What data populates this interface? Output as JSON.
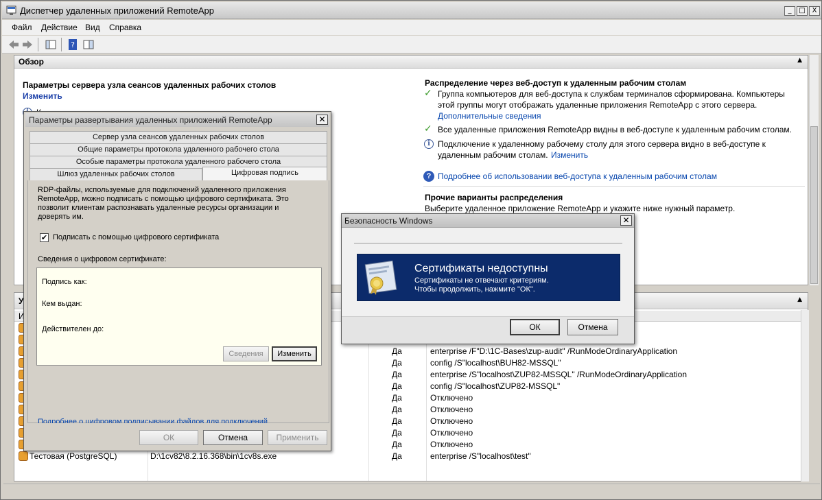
{
  "window": {
    "title": "Диспетчер удаленных приложений RemoteApp",
    "minimize": "_",
    "maximize": "□",
    "close": "X"
  },
  "menu": [
    "Файл",
    "Действие",
    "Вид",
    "Справка"
  ],
  "overview": {
    "header": "Обзор",
    "left": {
      "heading": "Параметры сервера узла сеансов удаленных рабочих столов",
      "change_link": "Изменить",
      "partial_text": "К"
    },
    "right": {
      "heading": "Распределение через веб-доступ к удаленным рабочим столам",
      "item1_line1": "Группа компьютеров для веб-доступа к службам терминалов сформирована. Компьютеры",
      "item1_line2": "этой группы могут отображать удаленные приложения RemoteApp с этого сервера.",
      "item1_link": "Дополнительные сведения",
      "item2": "Все удаленные приложения RemoteApp видны в веб-доступе к удаленным рабочим столам.",
      "item3_line1": "Подключение к удаленному рабочему столу для этого сервера видно в веб-доступе к",
      "item3_line2": "удаленным рабочим столам.",
      "item3_link": "Изменить",
      "help_link": "Подробнее об использовании веб-доступа к удаленным рабочим столам",
      "other_heading": "Прочие варианты распределения",
      "other_text": "Выберите удаленное приложение RemoteApp и укажите ниже нужный параметр."
    }
  },
  "programs": {
    "header_partial": "У",
    "col_partial": "И",
    "rows": [
      {
        "name": "",
        "path": "",
        "yes": "",
        "args": "ryApplication"
      },
      {
        "name": "",
        "path": "",
        "yes": "",
        "args": "ryApplication"
      },
      {
        "name": "",
        "path": "",
        "yes": "Да",
        "args": "enterprise /F\"D:\\1C-Bases\\zup-audit\" /RunModeOrdinaryApplication"
      },
      {
        "name": "",
        "path": "",
        "yes": "Да",
        "args": "config /S\"localhost\\BUH82-MSSQL\""
      },
      {
        "name": "",
        "path": "",
        "yes": "Да",
        "args": "enterprise /S\"localhost\\ZUP82-MSSQL\" /RunModeOrdinaryApplication"
      },
      {
        "name": "",
        "path": "",
        "yes": "Да",
        "args": "config /S\"localhost\\ZUP82-MSSQL\""
      },
      {
        "name": "",
        "path": "",
        "yes": "Да",
        "args": "Отключено"
      },
      {
        "name": "",
        "path": "calc.exe",
        "yes": "Да",
        "args": "Отключено"
      },
      {
        "name": "",
        "path": "writer.exe",
        "yes": "Да",
        "args": "Отключено"
      },
      {
        "name": "",
        "path": "xe",
        "yes": "Да",
        "args": "Отключено"
      },
      {
        "name": "",
        "path": "msc",
        "yes": "Да",
        "args": "Отключено"
      },
      {
        "name": "Тестовая (PostgreSQL)",
        "path": "D:\\1cv82\\8.2.16.368\\bin\\1cv8s.exe",
        "yes": "Да",
        "args": "enterprise /S\"localhost\\test\""
      }
    ]
  },
  "deploy_dialog": {
    "title": "Параметры развертывания удаленных приложений RemoteApp",
    "tabs": [
      "Сервер узла сеансов удаленных рабочих столов",
      "Общие параметры протокола удаленного рабочего стола",
      "Особые параметры протокола удаленного рабочего стола",
      "Шлюз удаленных рабочих столов",
      "Цифровая подпись"
    ],
    "description_lines": [
      "RDP-файлы, используемые для подключений удаленного приложения",
      "RemoteApp, можно подписать с помощью цифрового сертификата. Это",
      "позволит клиентам распознавать удаленные ресурсы организации и",
      "доверять им."
    ],
    "checkbox_label": "Подписать с помощью цифрового сертификата",
    "checkbox_mark": "✔",
    "cert_group_label": "Сведения о цифровом сертификате:",
    "signed_as": "Подпись как:",
    "issued_by": "Кем выдан:",
    "valid_until": "Действителен до:",
    "details_button": "Сведения",
    "change_button": "Изменить",
    "help_link": "Подробнее о цифровом подписывании файлов для подключений",
    "ok_button": "ОК",
    "cancel_button": "Отмена",
    "apply_button": "Применить"
  },
  "security_dialog": {
    "title": "Безопасность Windows",
    "banner_title": "Сертификаты недоступны",
    "banner_line1": "Сертификаты не отвечают критериям.",
    "banner_line2": "Чтобы продолжить, нажмите \"ОК\".",
    "ok_button": "ОК",
    "cancel_button": "Отмена"
  }
}
